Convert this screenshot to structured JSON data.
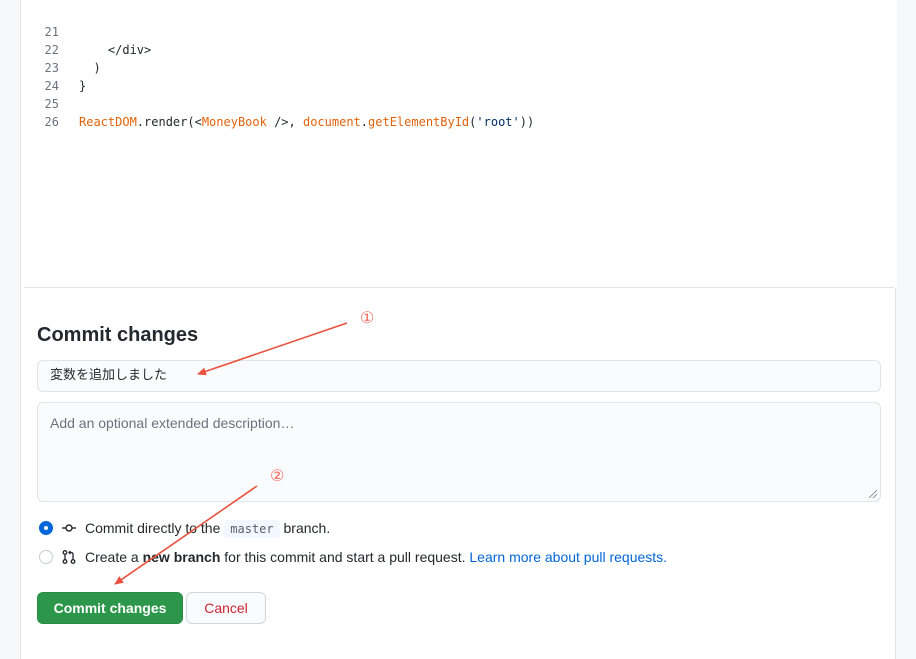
{
  "code_lines": [
    {
      "num": "21",
      "text": "    </div>"
    },
    {
      "num": "22",
      "text": "  )"
    },
    {
      "num": "23",
      "text": "}"
    },
    {
      "num": "24",
      "text": ""
    },
    {
      "num": "25",
      "parts": [
        "ReactDOM",
        ".render(<",
        "MoneyBook",
        " />, ",
        "document",
        ".",
        "getElementById",
        "(",
        "'root'",
        "))"
      ]
    },
    {
      "num": "26",
      "text": ""
    }
  ],
  "commit": {
    "title": "Commit changes",
    "summary_value": "変数を追加しました",
    "description_placeholder": "Add an optional extended description…",
    "option_direct_prefix": "Commit directly to the",
    "option_direct_branch": "master",
    "option_direct_suffix": "branch.",
    "option_new_prefix": "Create a",
    "option_new_bold": "new branch",
    "option_new_suffix": "for this commit and start a pull request.",
    "option_new_link": "Learn more about pull requests.",
    "submit_label": "Commit changes",
    "cancel_label": "Cancel"
  },
  "annotations": {
    "one": "①",
    "two": "②"
  },
  "colors": {
    "primary": "#2c974b",
    "cancel_text": "#cb2431",
    "link": "#0366d6",
    "annotation": "#f26b5b"
  }
}
